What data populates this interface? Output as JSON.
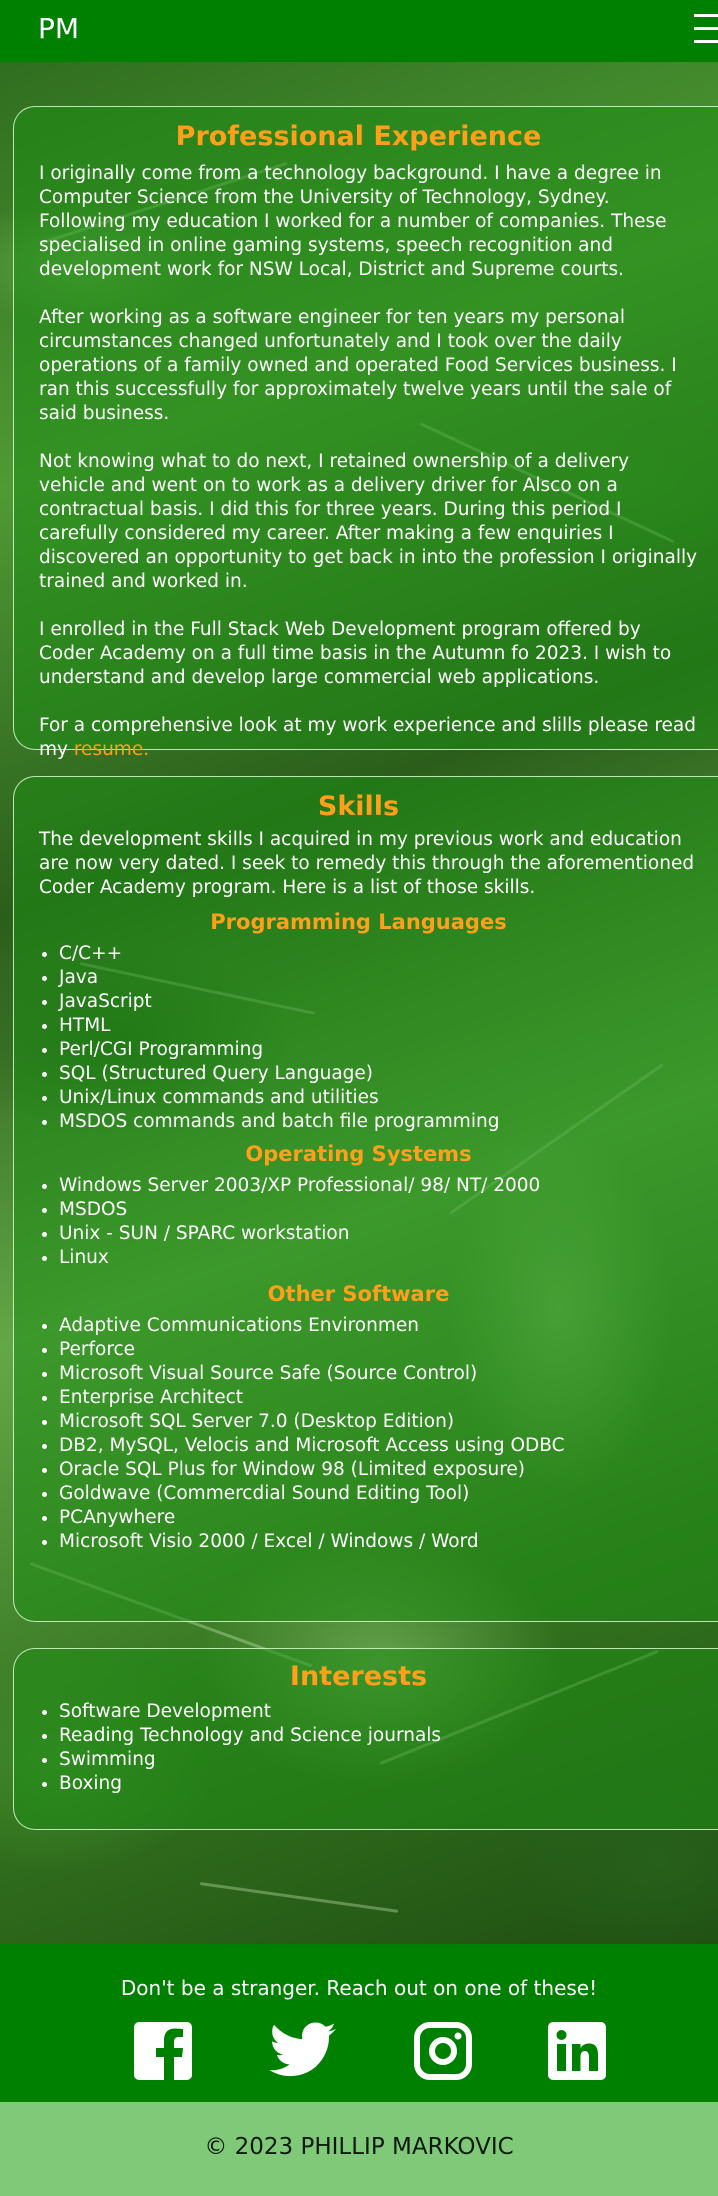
{
  "header": {
    "logo": "PM",
    "menu_icon": "hamburger-menu-icon"
  },
  "experience": {
    "title": "Professional Experience",
    "paragraphs": [
      "I originally come from a technology background. I have a degree in Computer Science from the University of Technology, Sydney. Following my education I worked for a number of companies. These specialised in online gaming systems, speech recognition and development work for NSW Local, District and Supreme courts.",
      "After working as a software engineer for ten years my personal circumstances changed unfortunately and I took over the daily operations of a family owned and operated Food Services business. I ran this successfully for approximately twelve years until the sale of said business.",
      "Not knowing what to do next, I retained ownership of a delivery vehicle and went on to work as a delivery driver for Alsco on a contractual basis. I did this for three years. During this period I carefully considered my career. After making a few enquiries I discovered an opportunity to get back in into the profession I originally trained and worked in.",
      "I enrolled in the Full Stack Web Development program offered by Coder Academy on a full time basis in the Autumn fo 2023. I wish to understand and develop large commercial web applications."
    ],
    "resume_text": "For a comprehensive look at my work experience and slills please read my ",
    "resume_link": "resume."
  },
  "skills": {
    "title": "Skills",
    "intro": "The development skills I acquired in my previous work and education are now very dated. I seek to remedy this through the aforementioned Coder Academy program. Here is a list of those skills.",
    "programming_title": "Programming Languages",
    "programming": [
      "C/C++",
      "Java",
      "JavaScript",
      "HTML",
      "Perl/CGI Programming",
      "SQL (Structured Query Language)",
      "Unix/Linux commands and utilities",
      "MSDOS commands and batch file programming"
    ],
    "os_title": "Operating Systems",
    "os": [
      "Windows Server 2003/XP Professional/ 98/ NT/ 2000",
      "MSDOS",
      "Unix - SUN / SPARC workstation",
      "Linux"
    ],
    "other_title": "Other Software",
    "other": [
      "Adaptive Communications Environmen",
      "Perforce",
      "Microsoft Visual Source Safe (Source Control)",
      "Enterprise Architect",
      "Microsoft SQL Server 7.0 (Desktop Edition)",
      "DB2, MySQL, Velocis and Microsoft Access using ODBC",
      "Oracle SQL Plus for Window 98 (Limited exposure)",
      "Goldwave (Commercdial Sound Editing Tool)",
      "PCAnywhere",
      "Microsoft Visio 2000 / Excel / Windows / Word"
    ]
  },
  "interests": {
    "title": "Interests",
    "items": [
      "Software Development",
      "Reading Technology and Science journals",
      "Swimming",
      "Boxing"
    ]
  },
  "footer": {
    "contact_text": "Don't be a stranger. Reach out on one of these!",
    "social_icons": [
      "facebook-icon",
      "twitter-icon",
      "instagram-icon",
      "linkedin-icon"
    ],
    "copyright": "© 2023 PHILLIP MARKOVIC"
  },
  "colors": {
    "header": "#008000",
    "accent": "#ff9f1a",
    "copyright_bar": "#80c979"
  }
}
